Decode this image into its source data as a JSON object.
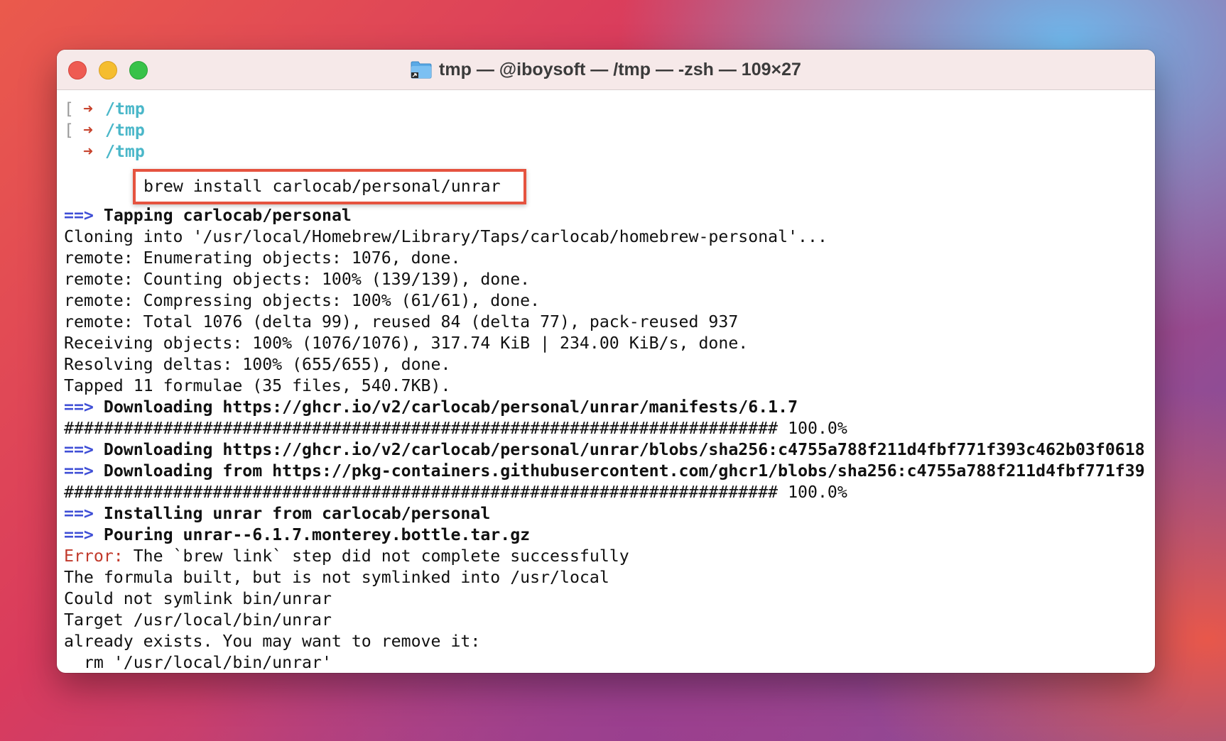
{
  "window": {
    "title": "tmp — @iboysoft — /tmp — -zsh — 109×27",
    "title_icon": "folder-icon"
  },
  "colors": {
    "arrow": "#c8442e",
    "cwd": "#4ab7c9",
    "marker": "#3f4fd6",
    "error": "#c1392b",
    "highlight_box": "#e5533f"
  },
  "prompts": [
    {
      "cwd": "/tmp"
    },
    {
      "cwd": "/tmp"
    },
    {
      "cwd": "/tmp",
      "command": "brew install carlocab/personal/unrar"
    }
  ],
  "output": {
    "tap_marker": "==>",
    "tap_heading": "Tapping carlocab/personal",
    "clone": "Cloning into '/usr/local/Homebrew/Library/Taps/carlocab/homebrew-personal'...",
    "enum": "remote: Enumerating objects: 1076, done.",
    "count": "remote: Counting objects: 100% (139/139), done.",
    "compress": "remote: Compressing objects: 100% (61/61), done.",
    "total": "remote: Total 1076 (delta 99), reused 84 (delta 77), pack-reused 937",
    "receive": "Receiving objects: 100% (1076/1076), 317.74 KiB | 234.00 KiB/s, done.",
    "resolve": "Resolving deltas: 100% (655/655), done.",
    "tapped": "Tapped 11 formulae (35 files, 540.7KB).",
    "dl1_marker": "==>",
    "dl1": "Downloading https://ghcr.io/v2/carlocab/personal/unrar/manifests/6.1.7",
    "progress1": "######################################################################## 100.0%",
    "dl2_marker": "==>",
    "dl2": "Downloading https://ghcr.io/v2/carlocab/personal/unrar/blobs/sha256:c4755a788f211d4fbf771f393c462b03f0618",
    "dl3_marker": "==>",
    "dl3": "Downloading from https://pkg-containers.githubusercontent.com/ghcr1/blobs/sha256:c4755a788f211d4fbf771f39",
    "progress2": "######################################################################## 100.0%",
    "install_marker": "==>",
    "install": "Installing unrar from carlocab/personal",
    "pour_marker": "==>",
    "pour": "Pouring unrar--6.1.7.monterey.bottle.tar.gz",
    "error_label": "Error:",
    "error_msg": " The `brew link` step did not complete successfully",
    "built": "The formula built, but is not symlinked into /usr/local",
    "nosymlink": "Could not symlink bin/unrar",
    "target": "Target /usr/local/bin/unrar",
    "exists": "already exists. You may want to remove it:",
    "rm": "  rm '/usr/local/bin/unrar'"
  }
}
